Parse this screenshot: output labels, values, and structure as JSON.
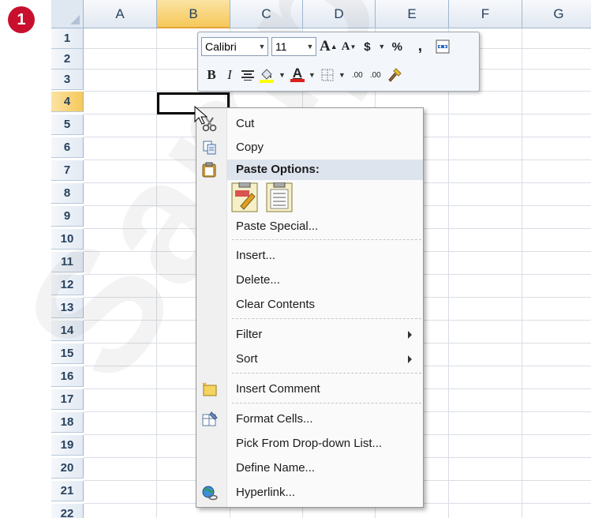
{
  "step_badge": "1",
  "columns": [
    "A",
    "B",
    "C",
    "D",
    "E",
    "F",
    "G"
  ],
  "selected_column": "B",
  "rows": [
    "1",
    "2",
    "3",
    "4",
    "5",
    "6",
    "7",
    "8",
    "9",
    "10",
    "11",
    "12",
    "13",
    "14",
    "15",
    "16",
    "17",
    "18",
    "19",
    "20",
    "21",
    "22"
  ],
  "selected_row": "4",
  "mini_toolbar": {
    "font_name": "Calibri",
    "font_size": "11",
    "grow_font": "A",
    "shrink_font": "A",
    "currency": "$",
    "percent": "%",
    "comma": ",",
    "bold": "B",
    "italic": "I",
    "font_color_letter": "A",
    "increase_decimal": ".00",
    "decrease_decimal": ".00"
  },
  "context_menu": {
    "cut": "Cut",
    "copy": "Copy",
    "paste_options_header": "Paste Options:",
    "paste_special": "Paste Special...",
    "insert": "Insert...",
    "delete": "Delete...",
    "clear_contents": "Clear Contents",
    "filter": "Filter",
    "sort": "Sort",
    "insert_comment": "Insert Comment",
    "format_cells": "Format Cells...",
    "pick_from_list": "Pick From Drop-down List...",
    "define_name": "Define Name...",
    "hyperlink": "Hyperlink..."
  },
  "watermark": "Sample",
  "colors": {
    "badge": "#c8102e",
    "selected_header": "#f5c85a",
    "header_border": "#9eb6ce",
    "menu_highlight": "#dde4ee"
  }
}
